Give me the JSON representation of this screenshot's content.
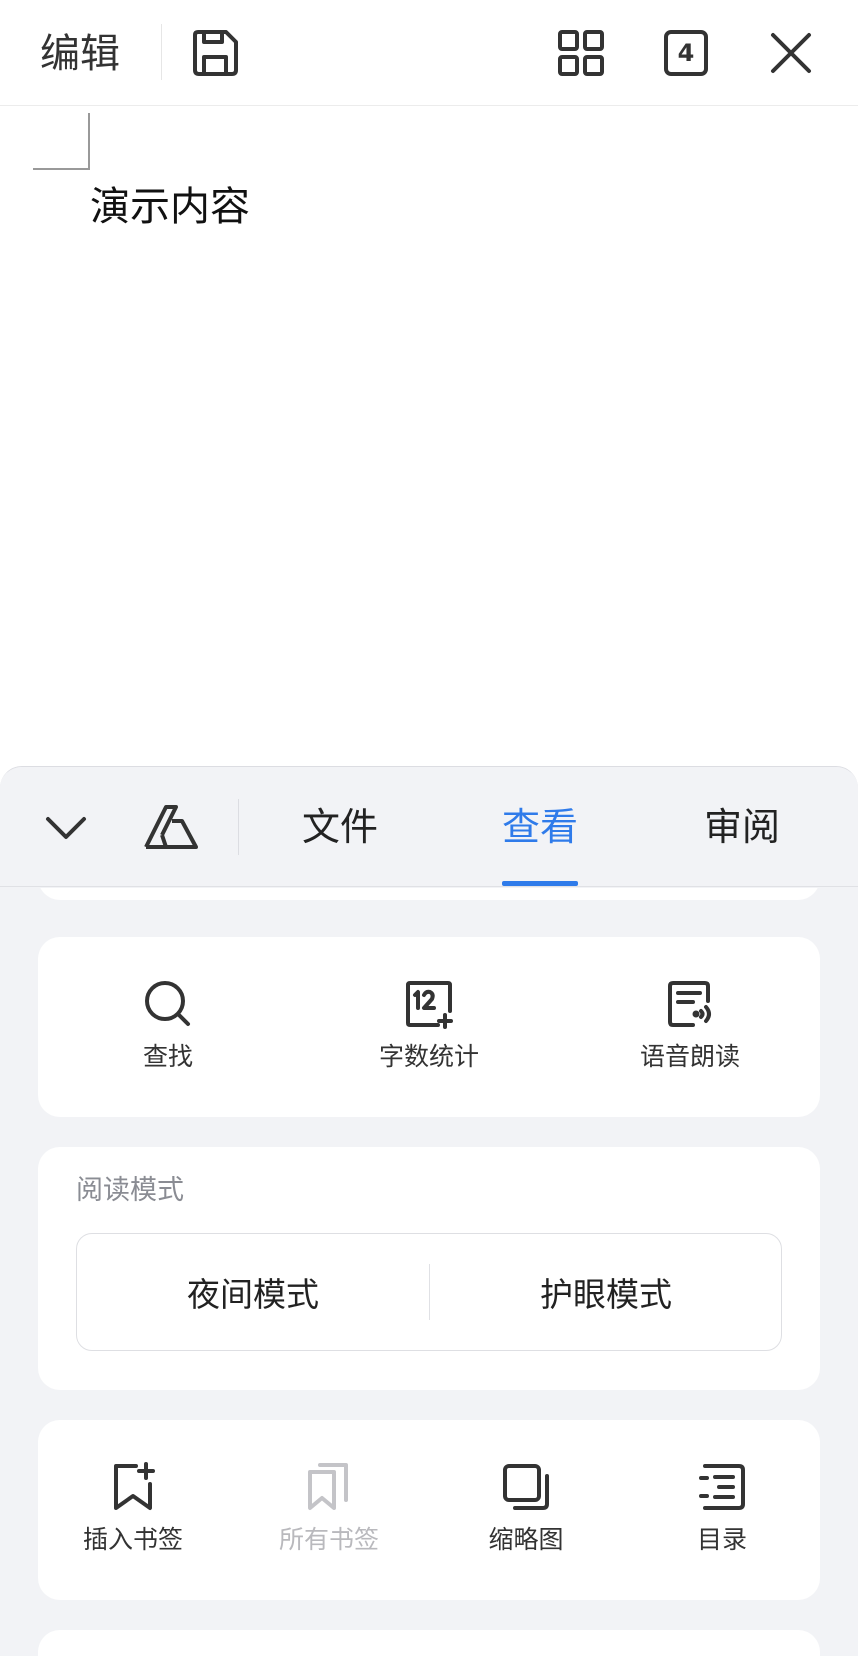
{
  "topbar": {
    "edit_label": "编辑",
    "tab_count": "4",
    "icons": [
      "save-icon",
      "grid-icon",
      "tab-count-icon",
      "close-icon"
    ]
  },
  "document": {
    "text": "演示内容"
  },
  "panel": {
    "tabs": [
      {
        "label": "文件",
        "active": false
      },
      {
        "label": "查看",
        "active": true
      },
      {
        "label": "审阅",
        "active": false
      }
    ],
    "accent_color": "#2f7bea",
    "tools": [
      {
        "label": "查找",
        "icon": "search-icon"
      },
      {
        "label": "字数统计",
        "icon": "word-count-icon"
      },
      {
        "label": "语音朗读",
        "icon": "read-aloud-icon"
      }
    ],
    "reading_mode": {
      "title": "阅读模式",
      "night": "夜间模式",
      "eye_care": "护眼模式"
    },
    "bookmarks": [
      {
        "label": "插入书签",
        "icon": "insert-bookmark-icon",
        "enabled": true
      },
      {
        "label": "所有书签",
        "icon": "all-bookmarks-icon",
        "enabled": false
      },
      {
        "label": "缩略图",
        "icon": "thumbnail-icon",
        "enabled": true
      },
      {
        "label": "目录",
        "icon": "toc-icon",
        "enabled": true
      }
    ]
  }
}
